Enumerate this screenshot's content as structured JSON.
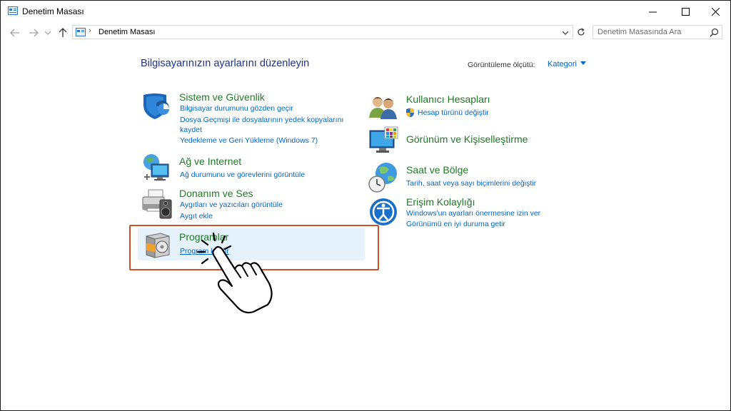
{
  "window": {
    "title": "Denetim Masası",
    "controls": [
      "minimize-icon",
      "maximize-icon",
      "close-icon"
    ]
  },
  "nav": {
    "back_icon": "arrow-left-icon",
    "forward_icon": "arrow-right-icon",
    "recent_icon": "chevron-down-icon",
    "up_icon": "arrow-up-icon"
  },
  "address": {
    "breadcrumb": "Denetim Masası"
  },
  "search": {
    "placeholder": "Denetim Masasında Ara"
  },
  "main": {
    "heading": "Bilgisayarınızın ayarlarını düzenleyin",
    "view_by_label": "Görüntüleme ölçütü:",
    "view_by_value": "Kategori"
  },
  "categories_left": [
    {
      "title": "Sistem ve Güvenlik",
      "icon": "shield-icon",
      "links": [
        "Bilgisayar durumunu gözden geçir",
        "Dosya Geçmişi ile dosyalarının yedek kopyalarını",
        "kaydet",
        "Yedekleme ve Geri Yükleme (Windows 7)"
      ]
    },
    {
      "title": "Ağ ve Internet",
      "icon": "network-globe-icon",
      "links": [
        "Ağ durumunu ve görevlerini görüntüle"
      ]
    },
    {
      "title": "Donanım ve Ses",
      "icon": "printer-speaker-icon",
      "links": [
        "Aygıtları ve yazıcıları görüntüle",
        "Aygıt ekle"
      ]
    },
    {
      "title": "Programlar",
      "icon": "programs-disc-icon",
      "links": [
        "Program kaldır"
      ]
    }
  ],
  "categories_right": [
    {
      "title": "Kullanıcı Hesapları",
      "icon": "users-icon",
      "links": [
        "Hesap türünü değiştir"
      ]
    },
    {
      "title": "Görünüm ve Kişiselleştirme",
      "icon": "display-palette-icon",
      "links": []
    },
    {
      "title": "Saat ve Bölge",
      "icon": "clock-globe-icon",
      "links": [
        "Tarih, saat veya sayı biçimlerini değiştir"
      ]
    },
    {
      "title": "Erişim Kolaylığı",
      "icon": "accessibility-icon",
      "links": [
        "Windows'un ayarları önermesine izin ver",
        "Görünümü en iyi duruma getir"
      ]
    }
  ],
  "colors": {
    "category_title": "#1f7a26",
    "link": "#0066cc",
    "heading": "#1e3287",
    "highlight": "#e5f1fb",
    "annotation_box": "#c9522b"
  }
}
